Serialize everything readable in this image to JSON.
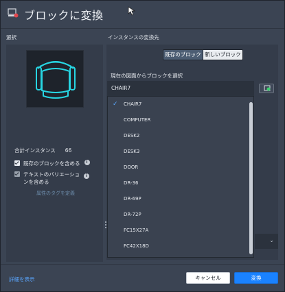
{
  "window": {
    "title": "ブロックに変換",
    "icon": "block-convert-icon"
  },
  "left": {
    "section_label": "選択",
    "instance_count_label": "合計インスタンス",
    "instance_count": "66",
    "include_existing_label": "既存のブロックを含める",
    "include_text_variation_label_line1": "テキストのバリエーショ",
    "include_text_variation_label_line2": "ンを含める",
    "define_attribute_tags_link": "属性のタグを定義"
  },
  "right": {
    "section_label": "インスタンスの変換先",
    "segments": [
      "既存のブロック",
      "新しいブロック"
    ],
    "active_segment": "既存のブロック",
    "select_from_drawing_label": "現在の図面からブロックを選択",
    "selected_block": "CHAIR7",
    "blocks": [
      "CHAIR7",
      "COMPUTER",
      "DESK2",
      "DESK3",
      "DOOR",
      "DR-36",
      "DR-69P",
      "DR-72P",
      "FC15X27A",
      "FC42X18D"
    ]
  },
  "footer": {
    "details_link": "詳細を表示",
    "cancel_label": "キャンセル",
    "ok_label": "変換"
  },
  "colors": {
    "accent": "#1a82ff",
    "link": "#5aa6ff",
    "preview_stroke": "#27d6e3"
  }
}
